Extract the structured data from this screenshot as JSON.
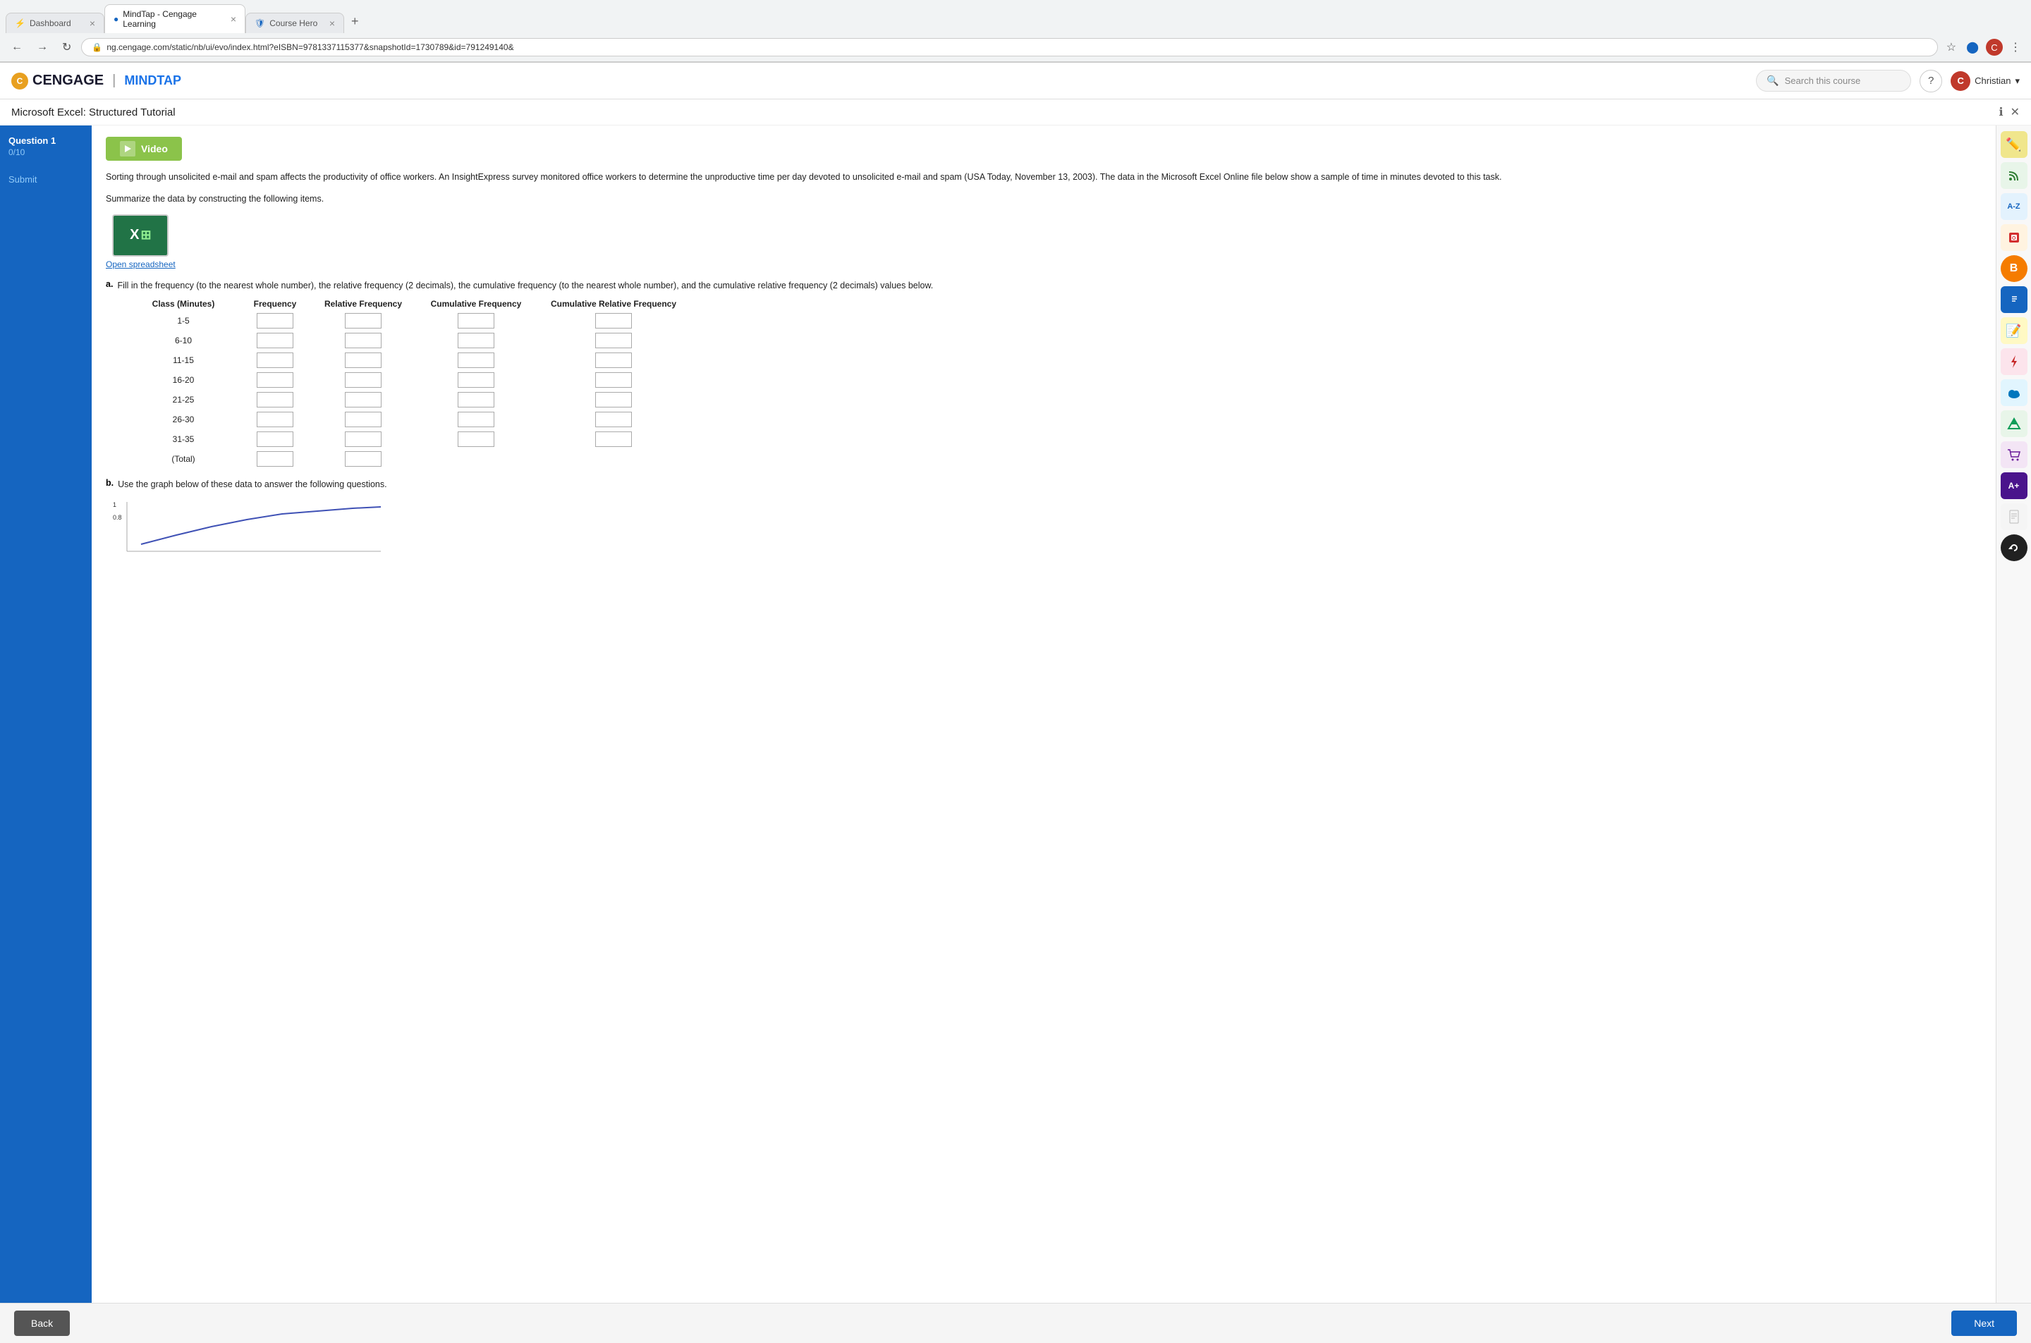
{
  "browser": {
    "tabs": [
      {
        "label": "Dashboard",
        "icon": "⚡",
        "active": false
      },
      {
        "label": "MindTap - Cengage Learning",
        "icon": "🔵",
        "active": true
      },
      {
        "label": "Course Hero",
        "icon": "🛡",
        "active": false
      }
    ],
    "url": "ng.cengage.com/static/nb/ui/evo/index.html?eISBN=9781337115377&snapshotId=1730789&id=791249140&"
  },
  "header": {
    "logo_cengage": "CENGAGE",
    "logo_divider": "|",
    "logo_mindtap": "MINDTAP",
    "search_placeholder": "Search this course",
    "user_name": "Christian",
    "user_initial": "C"
  },
  "page_title": "Microsoft Excel: Structured Tutorial",
  "sidebar": {
    "question_label": "Question 1",
    "question_score": "0/10",
    "submit_label": "Submit"
  },
  "content": {
    "video_label": "Video",
    "intro_text": "Sorting through unsolicited e-mail and spam affects the productivity of office workers. An InsightExpress survey monitored office workers to determine the unproductive time per day devoted to unsolicited e-mail and spam (USA Today, November 13, 2003). The data in the Microsoft Excel Online file below show a sample of time in minutes devoted to this task.",
    "summarize_text": "Summarize the data by constructing the following items.",
    "spreadsheet_link": "Open spreadsheet",
    "part_a_label": "a.",
    "part_a_text": "Fill in the frequency (to the nearest whole number), the relative frequency (2 decimals), the cumulative frequency (to the nearest whole number), and the cumulative relative frequency (2 decimals) values below.",
    "part_b_label": "b.",
    "part_b_text": "Use the graph below of these data to answer the following questions.",
    "table": {
      "headers": [
        "Class (Minutes)",
        "Frequency",
        "Relative Frequency",
        "Cumulative Frequency",
        "Cumulative Relative Frequency"
      ],
      "rows": [
        {
          "label": "1-5"
        },
        {
          "label": "6-10"
        },
        {
          "label": "11-15"
        },
        {
          "label": "16-20"
        },
        {
          "label": "21-25"
        },
        {
          "label": "26-30"
        },
        {
          "label": "31-35"
        },
        {
          "label": "(Total)"
        }
      ]
    }
  },
  "right_sidebar": {
    "icons": [
      {
        "name": "pencil-icon",
        "symbol": "✏️"
      },
      {
        "name": "rss-icon",
        "symbol": "📡"
      },
      {
        "name": "az-icon",
        "symbol": "A-Z"
      },
      {
        "name": "office-icon",
        "symbol": "⬛"
      },
      {
        "name": "orange-icon",
        "symbol": "🔶"
      },
      {
        "name": "book-icon",
        "symbol": "📘"
      },
      {
        "name": "notes-icon",
        "symbol": "📝"
      },
      {
        "name": "lightning-icon",
        "symbol": "⚡"
      },
      {
        "name": "cloud-icon",
        "symbol": "☁️"
      },
      {
        "name": "drive-icon",
        "symbol": "△"
      },
      {
        "name": "cart-icon",
        "symbol": "🛒"
      },
      {
        "name": "aplus-icon",
        "symbol": "A+"
      },
      {
        "name": "paper-icon",
        "symbol": "📄"
      },
      {
        "name": "circle-icon",
        "symbol": "↻"
      }
    ]
  },
  "bottom_bar": {
    "back_label": "Back",
    "next_label": "Next"
  }
}
